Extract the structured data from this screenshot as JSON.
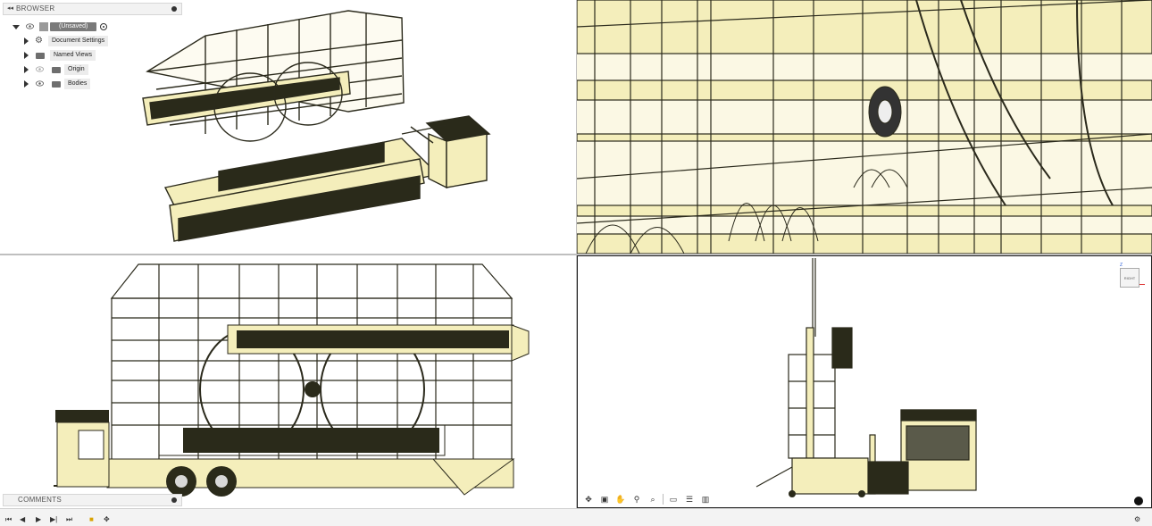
{
  "browser": {
    "title": "BROWSER",
    "root_label": "(Unsaved)",
    "items": [
      {
        "label": "Document Settings",
        "icon": "gear-icon"
      },
      {
        "label": "Named Views",
        "icon": "folder-icon"
      },
      {
        "label": "Origin",
        "icon": "folder-icon"
      },
      {
        "label": "Bodies",
        "icon": "folder-icon"
      }
    ]
  },
  "comments": {
    "title": "COMMENTS"
  },
  "viewcube": {
    "face": "RIGHT",
    "axis_z": "Z"
  },
  "colors": {
    "model_fill": "#f4eebb",
    "model_line": "#2b2a1c",
    "panel_bg": "#f2f2f2",
    "divider": "#bfbfbf"
  },
  "navbar": {
    "tools": [
      "orbit-icon",
      "look-at-icon",
      "pan-icon",
      "zoom-icon",
      "fit-icon",
      "display-settings-icon",
      "grid-icon",
      "viewports-icon"
    ]
  },
  "timeline": {
    "controls": [
      "first-icon",
      "previous-icon",
      "play-icon",
      "next-icon",
      "last-icon"
    ]
  }
}
